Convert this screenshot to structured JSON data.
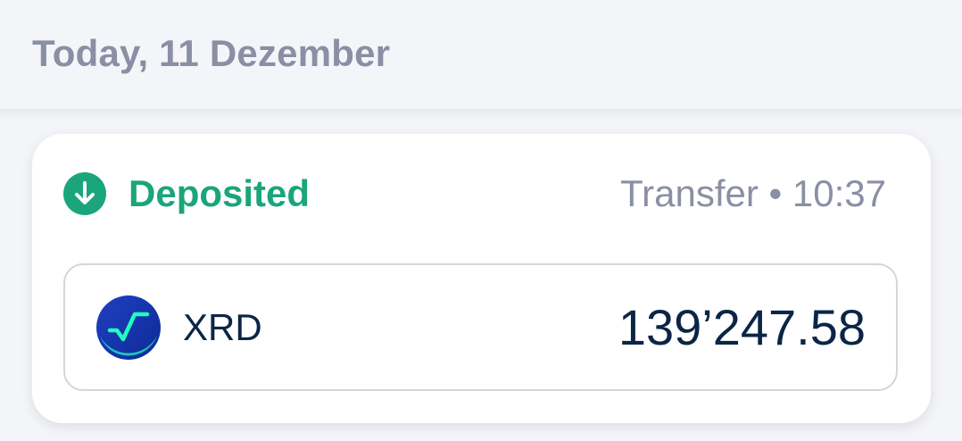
{
  "header": {
    "date_label": "Today, 11 Dezember"
  },
  "transaction": {
    "status_label": "Deposited",
    "status_icon": "arrow-down-circle-icon",
    "meta": "Transfer • 10:37",
    "asset": {
      "symbol": "XRD",
      "icon": "radix-token-icon",
      "amount": "139’247.58"
    }
  },
  "colors": {
    "background": "#f4f5f9",
    "deposited_green": "#1aa57a",
    "muted_text": "#8a8fa4",
    "primary_text": "#0b2546",
    "token_blue": "#1a3bb7",
    "token_accent": "#21ffbe"
  }
}
